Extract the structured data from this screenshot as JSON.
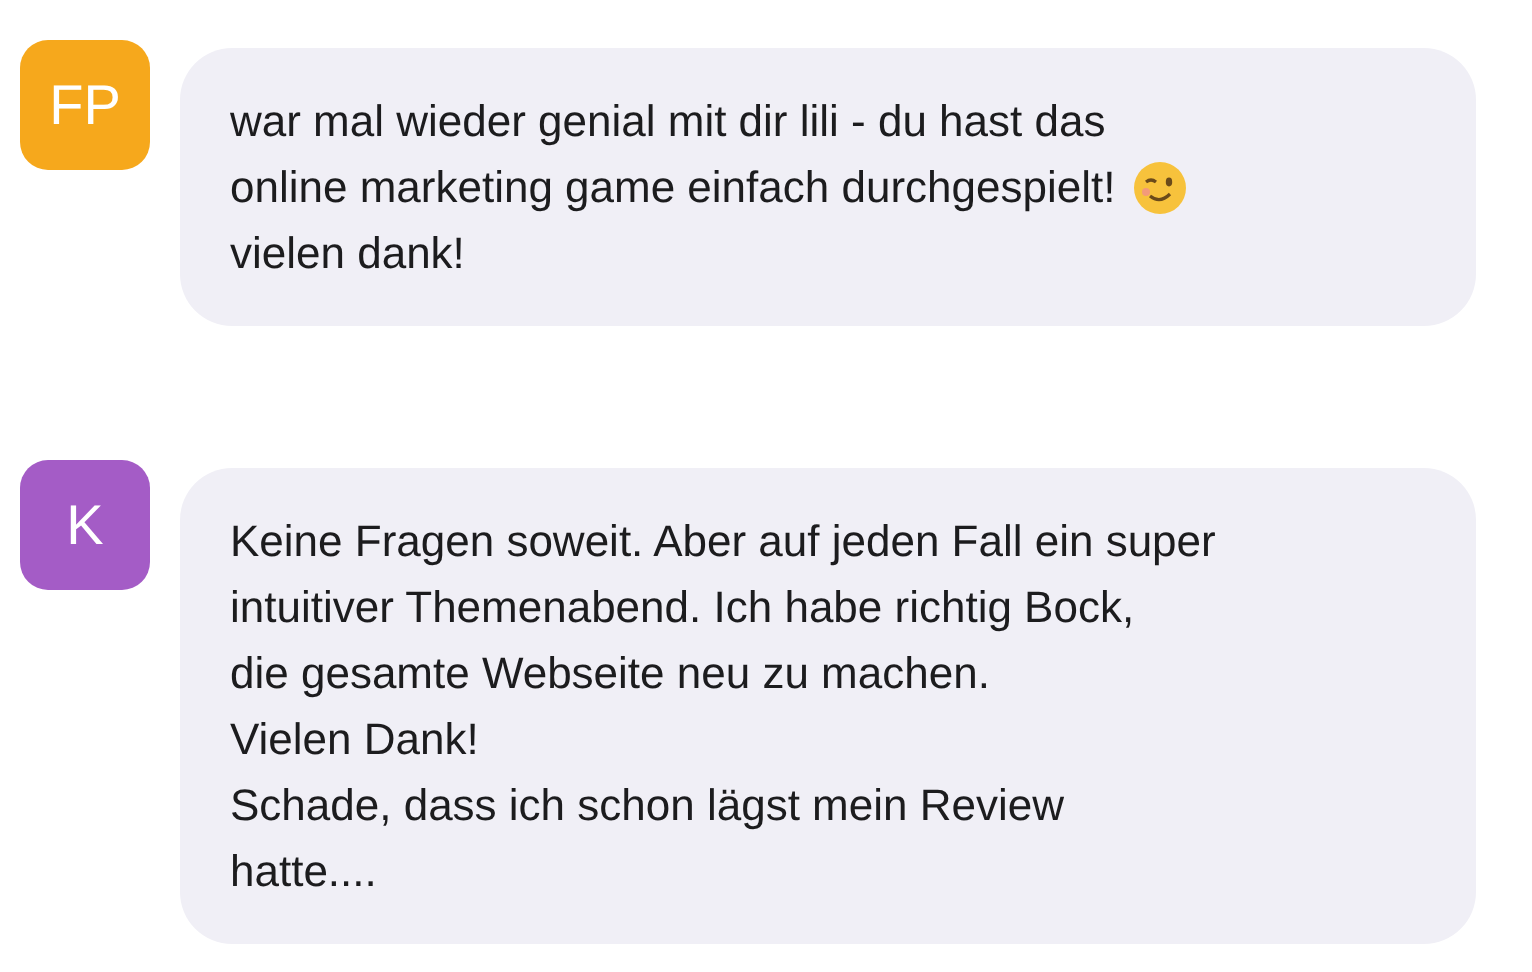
{
  "messages": [
    {
      "avatar": "FP",
      "color": "#f6a81c",
      "lines": [
        {
          "kind": "text",
          "text": "war mal wieder genial mit dir lili - du hast das"
        },
        {
          "kind": "emoji",
          "text": "online marketing game einfach durchgespielt!"
        },
        {
          "kind": "text",
          "text": "vielen dank!"
        }
      ]
    },
    {
      "avatar": "K",
      "color": "#a45cc6",
      "lines": [
        {
          "kind": "text",
          "text": "Keine Fragen soweit. Aber auf jeden Fall ein super"
        },
        {
          "kind": "text",
          "text": "intuitiver Themenabend. Ich habe richtig Bock,"
        },
        {
          "kind": "text",
          "text": "die gesamte Webseite neu zu machen."
        },
        {
          "kind": "text",
          "text": "Vielen Dank!"
        },
        {
          "kind": "text",
          "text": "Schade, dass ich schon lägst mein Review"
        },
        {
          "kind": "text",
          "text": "hatte...."
        }
      ]
    }
  ]
}
